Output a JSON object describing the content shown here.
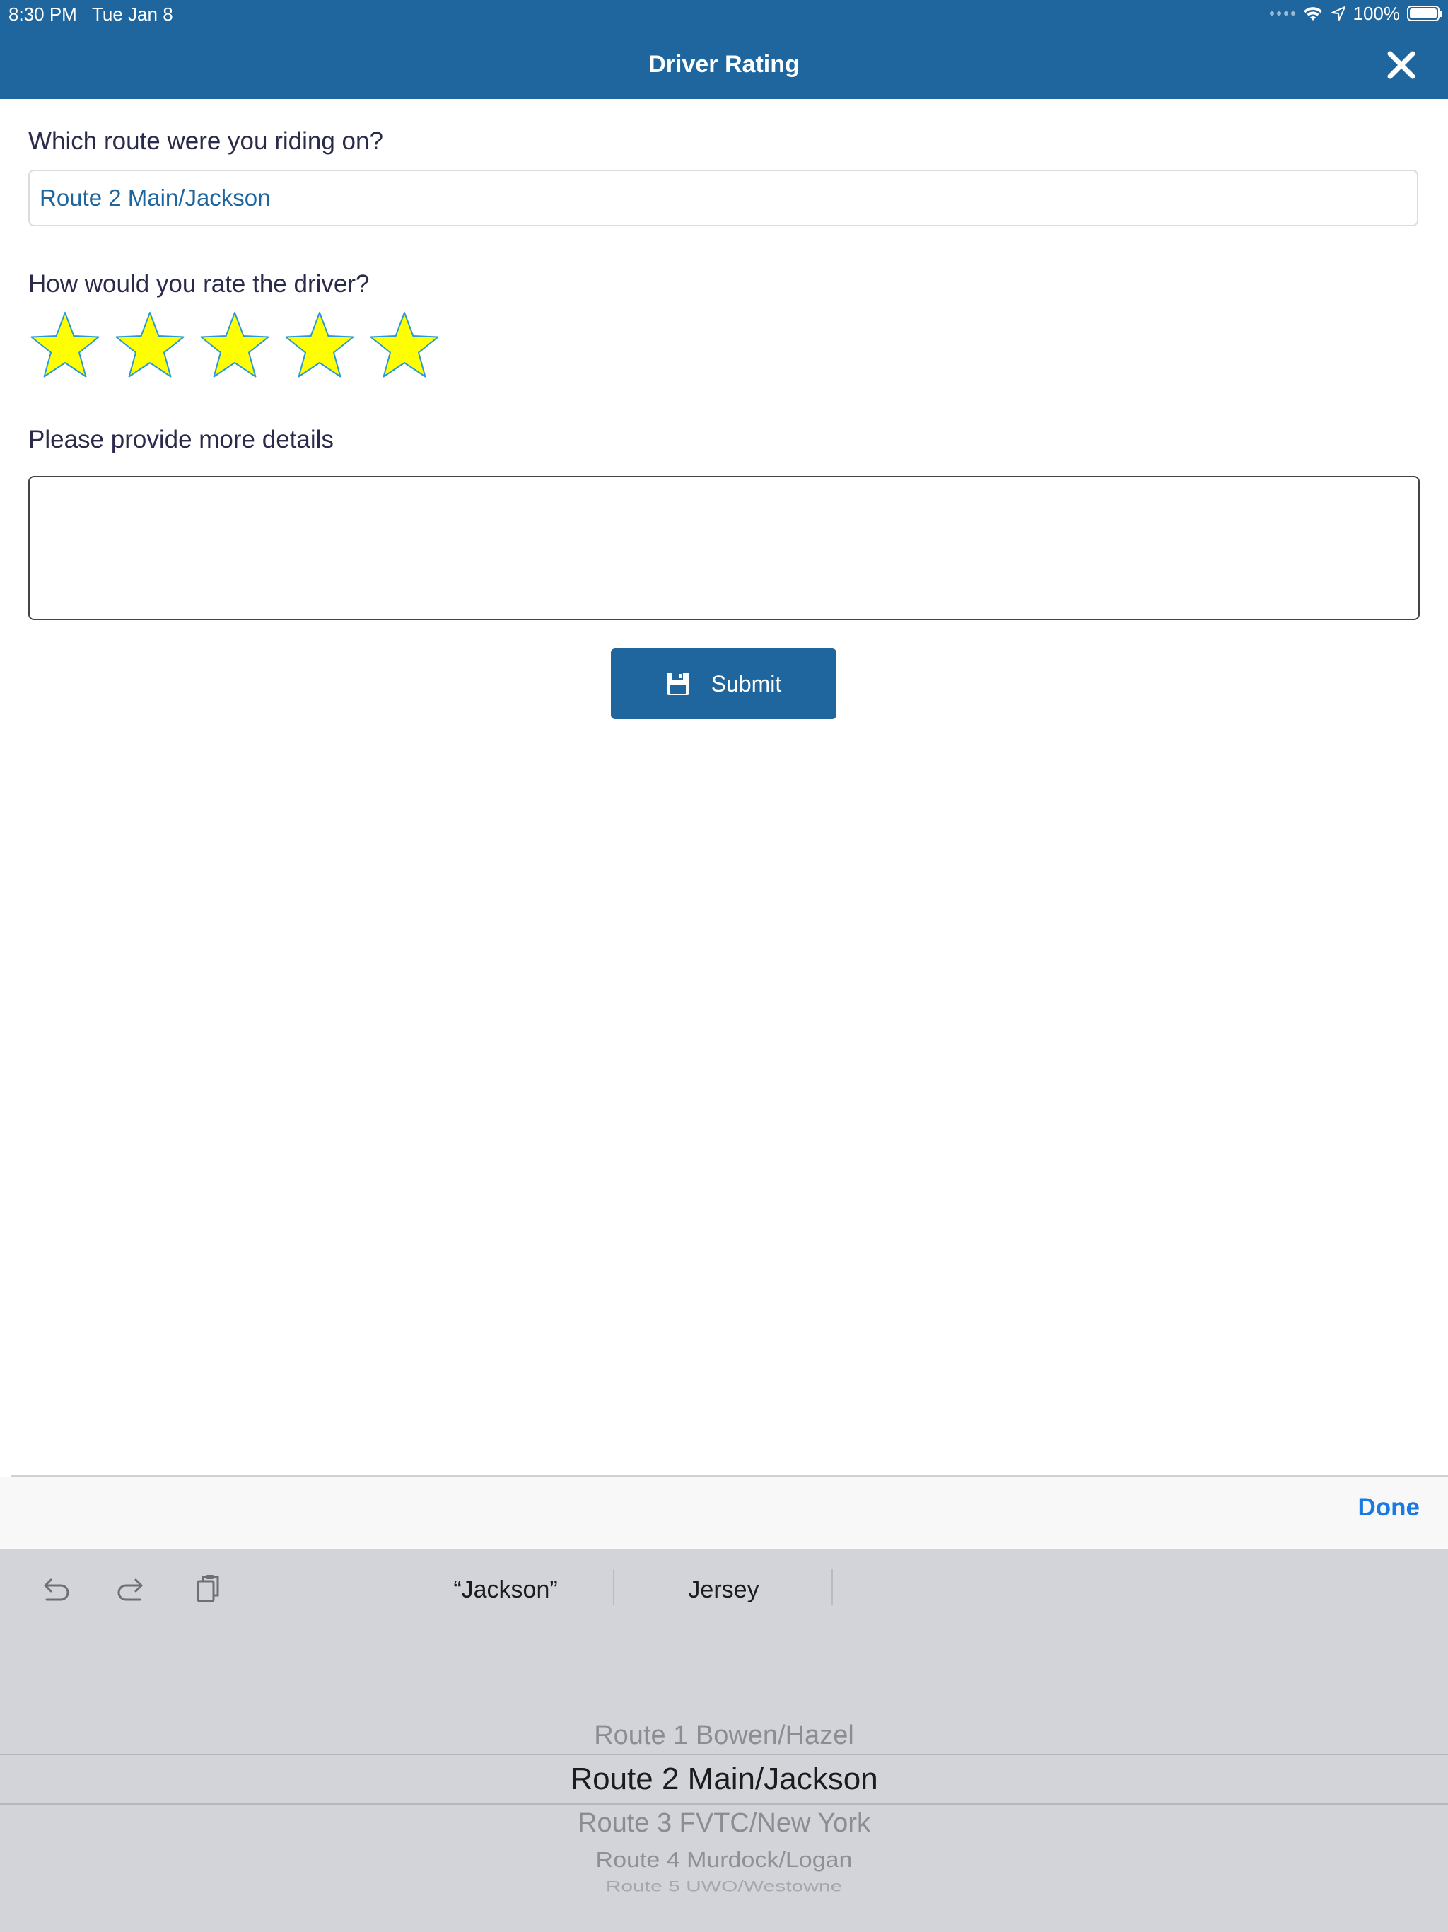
{
  "status_bar": {
    "time": "8:30 PM",
    "date": "Tue Jan 8",
    "battery": "100%"
  },
  "header": {
    "title": "Driver Rating"
  },
  "form": {
    "route_question": "Which route were you riding on?",
    "route_value": "Route 2 Main/Jackson",
    "rating_question": "How would you rate the driver?",
    "rating_value": 5,
    "rating_max": 5,
    "details_question": "Please provide more details",
    "details_value": "",
    "submit_label": "Submit"
  },
  "picker_toolbar": {
    "done_label": "Done"
  },
  "keyboard_bar": {
    "suggestions": [
      "“Jackson”",
      "Jersey"
    ]
  },
  "picker": {
    "selected_index": 1,
    "options": [
      "Route 1 Bowen/Hazel",
      "Route 2 Main/Jackson",
      "Route 3 FVTC/New York",
      "Route 4 Murdock/Logan",
      "Route 5 UWO/Westowne"
    ]
  },
  "colors": {
    "brand": "#1f669f",
    "star_fill": "#ffff00",
    "star_outline": "#2a9ad4",
    "done": "#1a7ae0"
  },
  "icons": {
    "close": "close-icon",
    "submit": "floppy-disk-icon",
    "undo": "undo-icon",
    "redo": "redo-icon",
    "paste": "paste-icon"
  }
}
